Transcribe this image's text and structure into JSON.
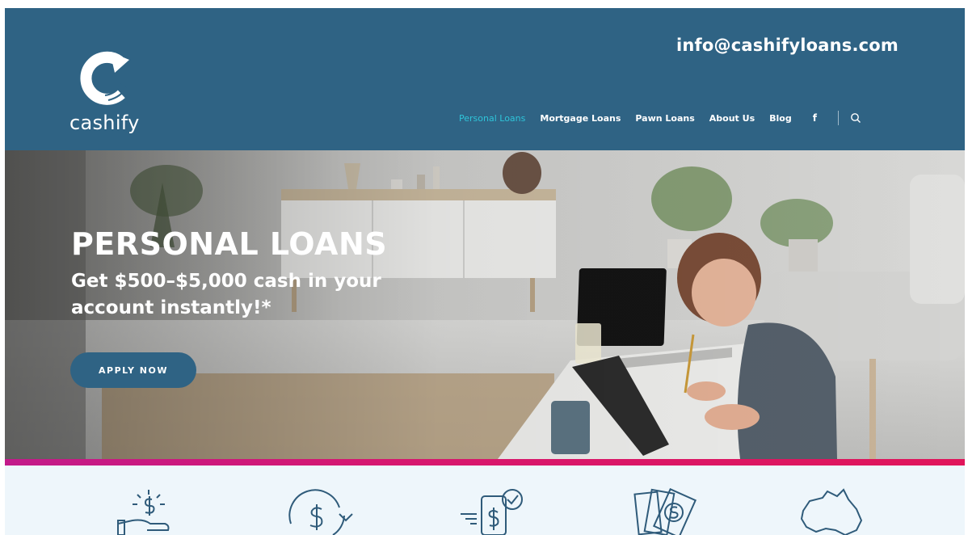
{
  "header": {
    "email": "info@cashifyloans.com",
    "logo_text": "cashify",
    "nav": [
      {
        "label": "Personal Loans",
        "active": true
      },
      {
        "label": "Mortgage Loans",
        "active": false
      },
      {
        "label": "Pawn Loans",
        "active": false
      },
      {
        "label": "About Us",
        "active": false
      },
      {
        "label": "Blog",
        "active": false
      }
    ],
    "facebook_glyph": "f",
    "icons": [
      "facebook-icon",
      "search-icon"
    ]
  },
  "hero": {
    "title": "PERSONAL LOANS",
    "subtitle": "Get $500–$5,000 cash in your account instantly!*",
    "cta_label": "APPLY NOW"
  },
  "features": {
    "icons": [
      "dollar-hand-icon",
      "dollar-cycle-icon",
      "fast-payment-phone-icon",
      "cash-notes-icon",
      "australia-map-icon"
    ]
  },
  "colors": {
    "header_bg": "#2f6384",
    "nav_active": "#2fc4d9",
    "accent_bar": "#d6176f",
    "features_bg": "#eef6fb",
    "icon_color": "#2f5b7a"
  }
}
